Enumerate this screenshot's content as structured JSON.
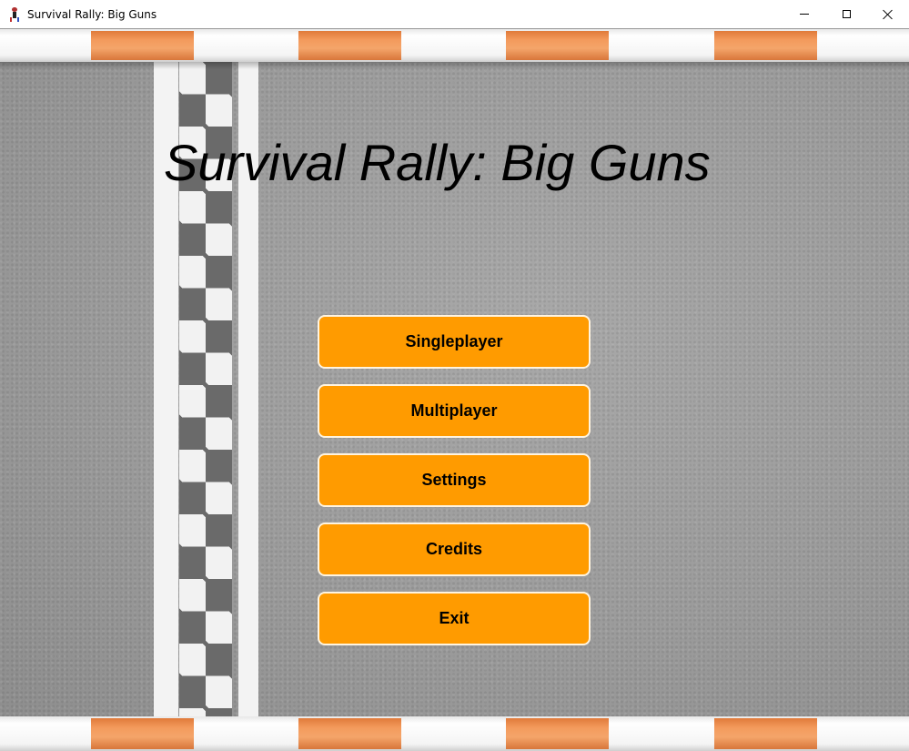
{
  "window": {
    "title": "Survival Rally: Big Guns",
    "controls": {
      "minimize_icon": "minimize-icon",
      "maximize_icon": "maximize-icon",
      "close_icon": "close-icon"
    }
  },
  "game": {
    "title": "Survival Rally: Big Guns"
  },
  "menu": {
    "items": [
      {
        "label": "Singleplayer"
      },
      {
        "label": "Multiplayer"
      },
      {
        "label": "Settings"
      },
      {
        "label": "Credits"
      },
      {
        "label": "Exit"
      }
    ]
  },
  "colors": {
    "button_fill": "#ff9b00",
    "curb_orange": "#f39a5c",
    "asphalt": "#9c9c9c",
    "checker_dark": "#6a6a6a"
  }
}
